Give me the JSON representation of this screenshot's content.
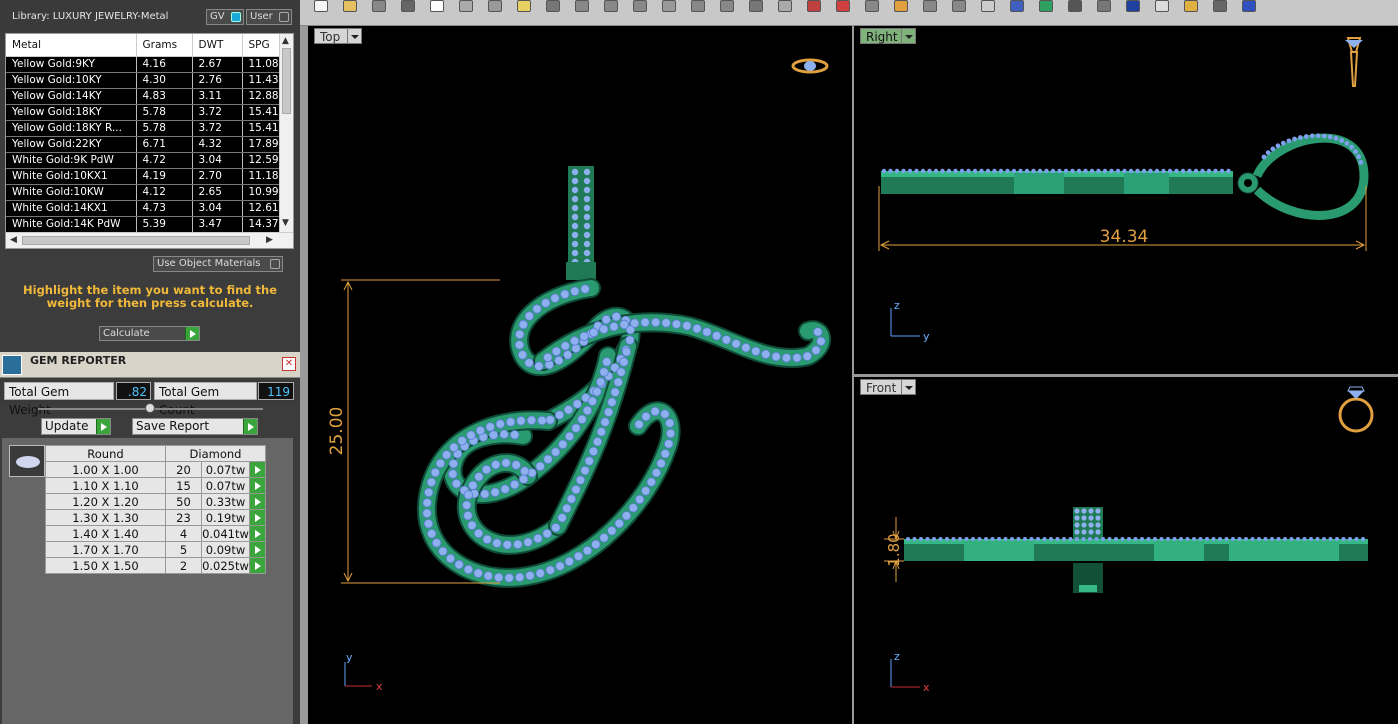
{
  "library": {
    "title": "Library: LUXURY JEWELRY-Metal",
    "gv_label": "GV",
    "user_label": "User",
    "columns": [
      "Metal",
      "Grams",
      "DWT",
      "SPG"
    ],
    "rows": [
      [
        "Yellow Gold:9KY",
        "4.16",
        "2.67",
        "11.08"
      ],
      [
        "Yellow Gold:10KY",
        "4.30",
        "2.76",
        "11.43"
      ],
      [
        "Yellow Gold:14KY",
        "4.83",
        "3.11",
        "12.88"
      ],
      [
        "Yellow Gold:18KY",
        "5.78",
        "3.72",
        "15.41"
      ],
      [
        "Yellow Gold:18KY R...",
        "5.78",
        "3.72",
        "15.41"
      ],
      [
        "Yellow Gold:22KY",
        "6.71",
        "4.32",
        "17.89"
      ],
      [
        "White Gold:9K PdW",
        "4.72",
        "3.04",
        "12.59"
      ],
      [
        "White Gold:10KX1",
        "4.19",
        "2.70",
        "11.18"
      ],
      [
        "White Gold:10KW",
        "4.12",
        "2.65",
        "10.99"
      ],
      [
        "White Gold:14KX1",
        "4.73",
        "3.04",
        "12.61"
      ],
      [
        "White Gold:14K PdW",
        "5.39",
        "3.47",
        "14.37"
      ]
    ],
    "use_object_materials": "Use Object Materials",
    "hint": "Highlight the item you want to find the weight for then press calculate.",
    "calculate_label": "Calculate"
  },
  "gem_reporter": {
    "title": "GEM REPORTER",
    "total_weight_label": "Total Gem Weight",
    "total_weight_value": ".82",
    "total_count_label": "Total Gem Count",
    "total_count_value": "119",
    "update_label": "Update",
    "save_label": "Save Report",
    "table_headers": [
      "Round",
      "Diamond"
    ],
    "gems": [
      {
        "size": "1.00 X 1.00",
        "count": "20",
        "tw": "0.07tw"
      },
      {
        "size": "1.10 X 1.10",
        "count": "15",
        "tw": "0.07tw"
      },
      {
        "size": "1.20 X 1.20",
        "count": "50",
        "tw": "0.33tw"
      },
      {
        "size": "1.30 X 1.30",
        "count": "23",
        "tw": "0.19tw"
      },
      {
        "size": "1.40 X 1.40",
        "count": "4",
        "tw": "0.041tw"
      },
      {
        "size": "1.70 X 1.70",
        "count": "5",
        "tw": "0.09tw"
      },
      {
        "size": "1.50 X 1.50",
        "count": "2",
        "tw": "0.025tw"
      }
    ]
  },
  "viewports": {
    "top": {
      "label": "Top",
      "dimension": "25.00",
      "axis_y": "y",
      "axis_x": "x"
    },
    "right": {
      "label": "Right",
      "dimension": "34.34",
      "axis_z": "z",
      "axis_y": "y"
    },
    "front": {
      "label": "Front",
      "dimension": "1.80",
      "axis_z": "z",
      "axis_x": "x"
    }
  },
  "colors": {
    "metal_green": "#2a9a70",
    "gem_blue": "#8fb0ee",
    "dimension_orange": "#e0a040",
    "highlight_yellow": "#f0b93a"
  }
}
